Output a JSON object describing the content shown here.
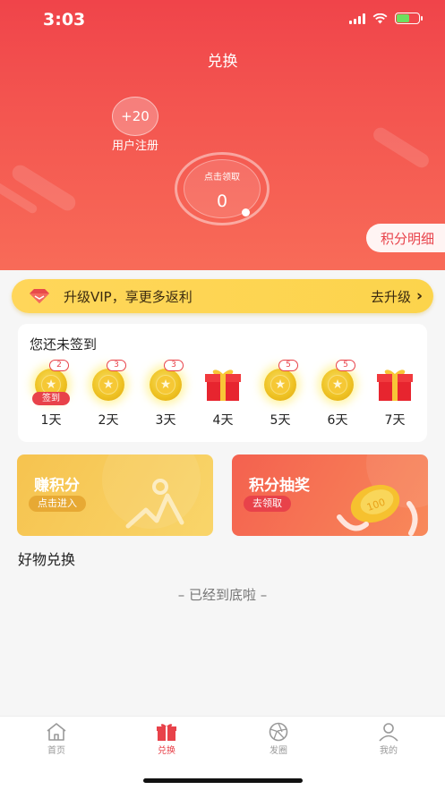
{
  "status_bar": {
    "time": "3:03"
  },
  "header": {
    "title": "兑换",
    "register": {
      "value": "+20",
      "label": "用户注册"
    },
    "claim": {
      "label": "点击领取",
      "value": "0"
    },
    "points_detail": "积分明细"
  },
  "vip": {
    "text": "升级VIP，享更多返利",
    "action": "去升级"
  },
  "sign_in": {
    "title": "您还未签到",
    "days": [
      {
        "label": "1天",
        "type": "coin",
        "badge": "2",
        "tag": "签到"
      },
      {
        "label": "2天",
        "type": "coin",
        "badge": "3"
      },
      {
        "label": "3天",
        "type": "coin",
        "badge": "3"
      },
      {
        "label": "4天",
        "type": "gift"
      },
      {
        "label": "5天",
        "type": "coin",
        "badge": "5"
      },
      {
        "label": "6天",
        "type": "coin",
        "badge": "5"
      },
      {
        "label": "7天",
        "type": "gift"
      }
    ]
  },
  "cards": {
    "earn": {
      "title": "赚积分",
      "button": "点击进入"
    },
    "lottery": {
      "title": "积分抽奖",
      "button": "去领取",
      "coin_text": "100"
    }
  },
  "section_title": "好物兑换",
  "end_text": "– 已经到底啦 –",
  "tabbar": [
    {
      "label": "首页",
      "icon": "home-icon",
      "active": false
    },
    {
      "label": "兑换",
      "icon": "gift-icon",
      "active": true
    },
    {
      "label": "发圈",
      "icon": "aperture-icon",
      "active": false
    },
    {
      "label": "我的",
      "icon": "user-icon",
      "active": false
    }
  ],
  "colors": {
    "primary": "#e8424a",
    "header": "#f3534f",
    "vip": "#fcd44c",
    "earn": "#f6c34f",
    "lottery": "#f4614f"
  }
}
